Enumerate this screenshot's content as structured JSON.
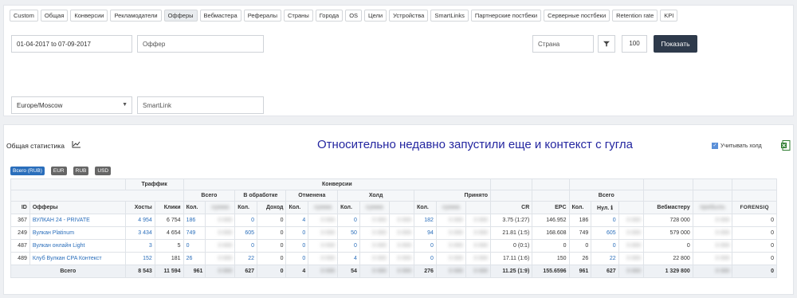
{
  "tabs": [
    {
      "label": "Custom",
      "active": false
    },
    {
      "label": "Общая",
      "active": false
    },
    {
      "label": "Конверсии",
      "active": false
    },
    {
      "label": "Рекламодатели",
      "active": false
    },
    {
      "label": "Офферы",
      "active": true
    },
    {
      "label": "Вебмастера",
      "active": false
    },
    {
      "label": "Рефералы",
      "active": false
    },
    {
      "label": "Страны",
      "active": false
    },
    {
      "label": "Города",
      "active": false
    },
    {
      "label": "OS",
      "active": false
    },
    {
      "label": "Цели",
      "active": false
    },
    {
      "label": "Устройства",
      "active": false
    },
    {
      "label": "SmartLinks",
      "active": false
    },
    {
      "label": "Партнерские постбеки",
      "active": false
    },
    {
      "label": "Серверные постбеки",
      "active": false
    },
    {
      "label": "Retention rate",
      "active": false
    },
    {
      "label": "KPI",
      "active": false
    }
  ],
  "filters": {
    "date_range": "01-04-2017 to 07-09-2017",
    "offer_placeholder": "Оффер",
    "country_placeholder": "Страна",
    "count": "100",
    "show_label": "Показать",
    "timezone": "Europe/Moscow",
    "smartlink_placeholder": "SmartLink"
  },
  "stats": {
    "title": "Общая статистика",
    "annotation": "Относительно недавно запустили еще и контекст с гугла",
    "hold_label": "Учитывать холд",
    "currencies": [
      {
        "label": "Всего (RUB)",
        "active": true
      },
      {
        "label": "EUR",
        "active": false
      },
      {
        "label": "RUB",
        "active": false
      },
      {
        "label": "USD",
        "active": false
      }
    ]
  },
  "table": {
    "group_headers": {
      "traffic": "Траффик",
      "conversions": "Конверсии",
      "total": "Всего",
      "in_process": "В обработке",
      "canceled": "Отменена",
      "hold": "Холд",
      "accepted": "Принято",
      "total2": "Всего"
    },
    "columns": {
      "id": "ID",
      "offers": "Офферы",
      "hosts": "Хосты",
      "clicks": "Клики",
      "qty": "Кол.",
      "income": "Доход",
      "cr": "CR",
      "epc": "EPC",
      "nul": "Нул.",
      "webmaster": "Вебмастеру",
      "forensiq": "FORENSIQ"
    },
    "rows": [
      {
        "id": "367",
        "offer": "ВУЛКАН 24 - PRIVATE",
        "hosts": "4 954",
        "clicks": "6 754",
        "total_qty": "186",
        "proc_qty": "0",
        "proc_income": "0",
        "canc_qty": "4",
        "hold_qty": "0",
        "acc_qty": "182",
        "cr": "3.75 (1:27)",
        "epc": "146.952",
        "all_qty": "186",
        "all_nul": "0",
        "webmaster": "728 000",
        "forensiq": "0"
      },
      {
        "id": "249",
        "offer": "Вулкан Platinum",
        "hosts": "3 434",
        "clicks": "4 654",
        "total_qty": "749",
        "proc_qty": "605",
        "proc_income": "0",
        "canc_qty": "0",
        "hold_qty": "50",
        "acc_qty": "94",
        "cr": "21.81 (1:5)",
        "epc": "168.608",
        "all_qty": "749",
        "all_nul": "605",
        "webmaster": "579 000",
        "forensiq": "0"
      },
      {
        "id": "487",
        "offer": "Вулкан онлайн Light",
        "hosts": "3",
        "clicks": "5",
        "total_qty": "0",
        "proc_qty": "0",
        "proc_income": "0",
        "canc_qty": "0",
        "hold_qty": "0",
        "acc_qty": "0",
        "cr": "0 (0:1)",
        "epc": "0",
        "all_qty": "0",
        "all_nul": "0",
        "webmaster": "0",
        "forensiq": "0"
      },
      {
        "id": "489",
        "offer": "Клуб Вулкан CPA Контекст",
        "hosts": "152",
        "clicks": "181",
        "total_qty": "26",
        "proc_qty": "22",
        "proc_income": "0",
        "canc_qty": "0",
        "hold_qty": "4",
        "acc_qty": "0",
        "cr": "17.11 (1:6)",
        "epc": "150",
        "all_qty": "26",
        "all_nul": "22",
        "webmaster": "22 800",
        "forensiq": "0"
      }
    ],
    "total": {
      "label": "Всего",
      "hosts": "8 543",
      "clicks": "11 594",
      "total_qty": "961",
      "proc_qty": "627",
      "proc_income": "0",
      "canc_qty": "4",
      "hold_qty": "54",
      "acc_qty": "276",
      "cr": "11.25 (1:9)",
      "epc": "155.6596",
      "all_qty": "961",
      "all_nul": "627",
      "webmaster": "1 329 800",
      "forensiq": "0"
    }
  }
}
